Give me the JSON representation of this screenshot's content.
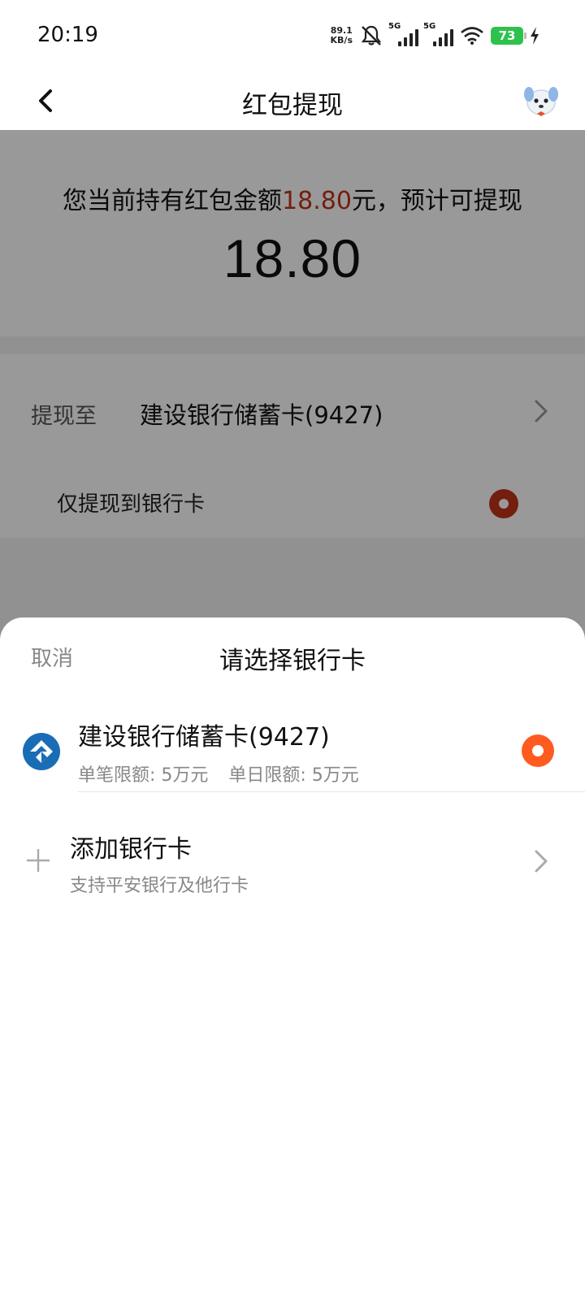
{
  "status_bar": {
    "time": "20:19",
    "net_speed_value": "89.1",
    "net_speed_unit": "KB/s",
    "signal_1_label": "5G",
    "signal_2_label": "5G",
    "battery_level": "73"
  },
  "header": {
    "title": "红包提现",
    "back_icon": "chevron-left-icon",
    "mascot_icon": "mascot-dog-icon"
  },
  "summary": {
    "prefix": "您当前持有红包金额",
    "amount_highlight": "18.80",
    "suffix": "元，预计可提现",
    "withdrawable_amount": "18.80",
    "highlight_color": "#c0321a"
  },
  "withdraw": {
    "label": "提现至",
    "target": "建设银行储蓄卡(9427)",
    "option_label": "仅提现到银行卡"
  },
  "sheet": {
    "cancel_label": "取消",
    "title": "请选择银行卡",
    "bank_card": {
      "name": "建设银行储蓄卡(9427)",
      "single_limit": "单笔限额:  5万元",
      "daily_limit": "单日限额:  5万元",
      "selected": true,
      "radio_color": "#ff5a1f",
      "logo_icon": "ccb-bank-logo-icon",
      "logo_color": "#1a6db5"
    },
    "add_card": {
      "title": "添加银行卡",
      "subtitle": "支持平安银行及他行卡",
      "icon": "plus-icon"
    }
  }
}
